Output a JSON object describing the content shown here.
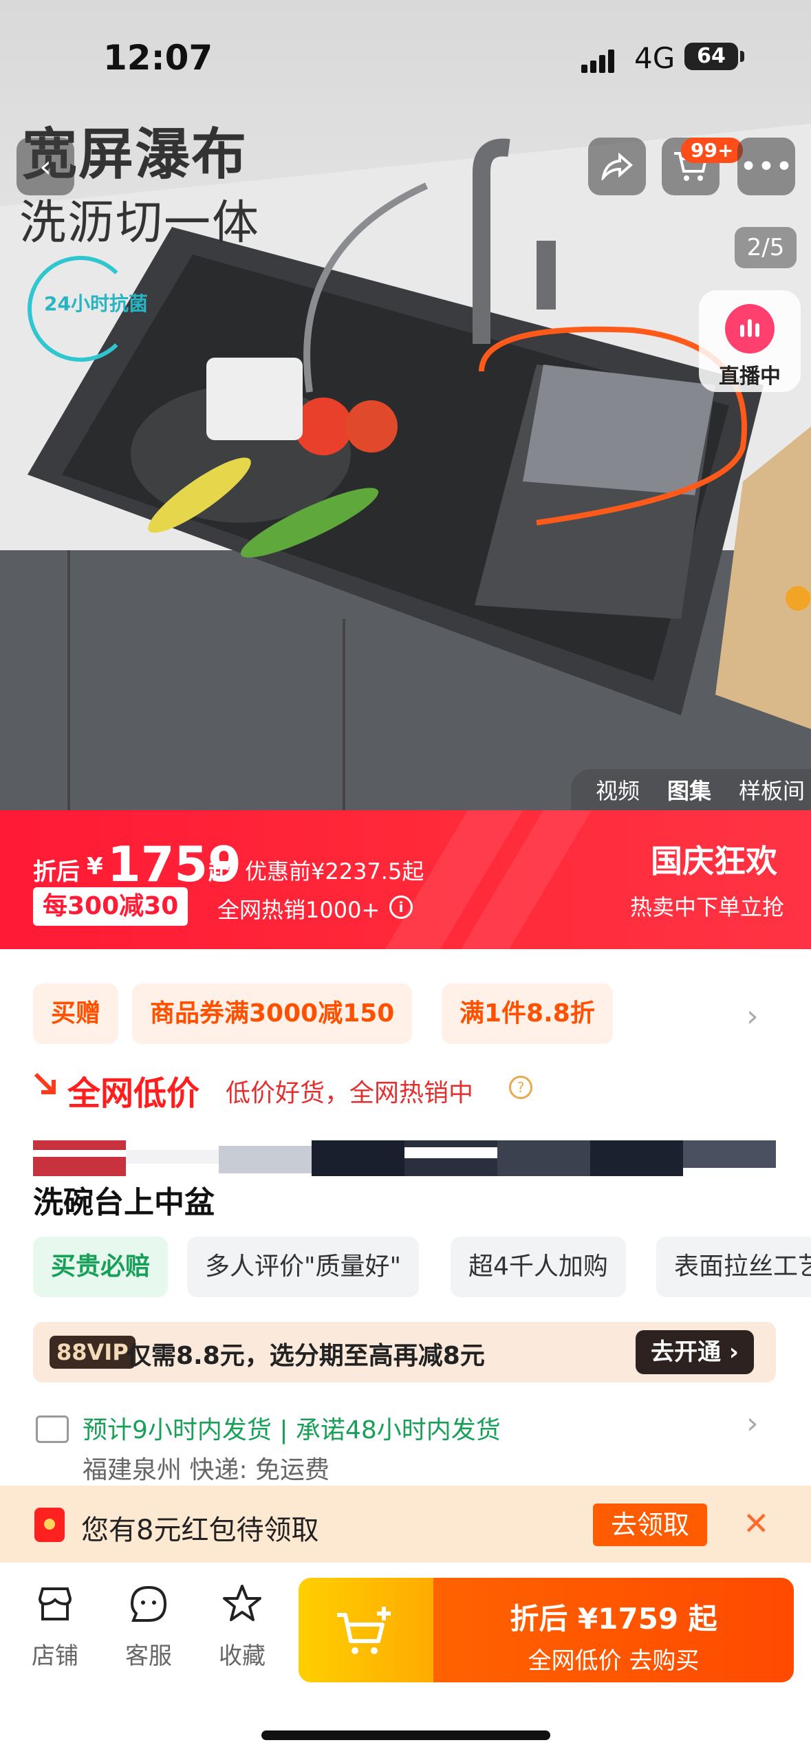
{
  "status_bar": {
    "time": "12:07",
    "network": "4G",
    "battery": "64"
  },
  "hero": {
    "title": "宽屏瀑布",
    "subtitle": "洗沥切一体",
    "badge": "24小时抗菌",
    "cart_count": "99+",
    "page_indicator": "2/5",
    "live_label": "直播中",
    "media_tabs": [
      "视频",
      "图集",
      "样板间"
    ]
  },
  "promo": {
    "prefix": "折后",
    "currency": "¥",
    "price": "1759",
    "suffix": "起",
    "original": "优惠前¥2237.5起",
    "coupon": "每300减30",
    "hot": "全网热销1000+",
    "event_title": "国庆狂欢",
    "event_sub": "热卖中下单立抢"
  },
  "offers": [
    "买赠",
    "商品券满3000减150",
    "满1件8.8折"
  ],
  "lowprice": {
    "title": "全网低价",
    "desc": "低价好货，全网热销中"
  },
  "product_title": "洗碗台上中盆",
  "tags": [
    "买贵必赔",
    "多人评价\"质量好\"",
    "超4千人加购",
    "表面拉丝工艺"
  ],
  "vip": {
    "logo": "88VIP",
    "text": "仅需8.8元，选分期至高再减8元",
    "button": "去开通 ›"
  },
  "shipping": {
    "text": "预计9小时内发货 | 承诺48小时内发货",
    "origin": "福建泉州  快递: 免运费"
  },
  "red_packet": {
    "text": "您有8元红包待领取",
    "button": "去领取",
    "close": "✕"
  },
  "bottom_bar": {
    "shop": "店铺",
    "service": "客服",
    "favorite": "收藏",
    "buy_price": "折后 ¥1759 起",
    "buy_sub": "全网低价  去购买"
  },
  "colors": {
    "accent": "#ff5000",
    "promo_red": "#ff1a35",
    "green": "#18a058"
  }
}
